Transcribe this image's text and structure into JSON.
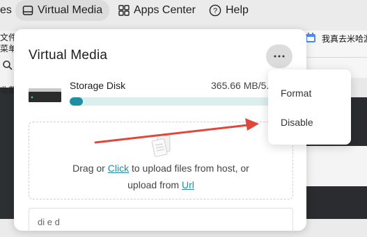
{
  "topnav": {
    "partial_label": "es",
    "virtual_media": "Virtual Media",
    "apps_center": "Apps Center",
    "help": "Help"
  },
  "background": {
    "left_texts": [
      "文件",
      "菜单",
      "",
      "收藏"
    ],
    "right_text": "我真去米哈游"
  },
  "panel": {
    "title": "Virtual Media",
    "more_icon": "ellipsis-icon",
    "disk": {
      "name": "Storage Disk",
      "size": "365.66 MB/5.",
      "usage_fraction": 0.06
    },
    "dropzone": {
      "line1_prefix": "Drag or ",
      "line1_link": "Click",
      "line1_suffix": " to upload files from host, or",
      "line2_prefix": "upload from ",
      "line2_link": "Url"
    },
    "bottom_text": "di  e    d"
  },
  "menu": {
    "items": [
      "Format",
      "Disable"
    ]
  },
  "colors": {
    "accent": "#1f8fa3",
    "annotation": "#e0463a"
  }
}
